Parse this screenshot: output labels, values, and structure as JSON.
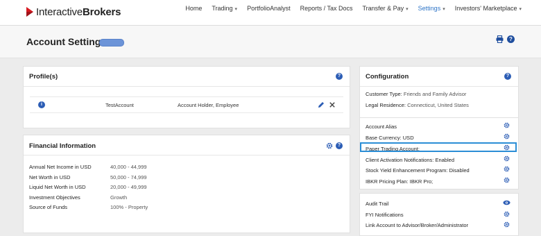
{
  "logo": {
    "part1": "Interactive",
    "part2": "Brokers"
  },
  "nav": [
    {
      "label": "Home",
      "caret": false
    },
    {
      "label": "Trading",
      "caret": true
    },
    {
      "label": "PortfolioAnalyst",
      "caret": false
    },
    {
      "label": "Reports / Tax Docs",
      "caret": false
    },
    {
      "label": "Transfer & Pay",
      "caret": true
    },
    {
      "label": "Settings",
      "caret": true,
      "active": true
    },
    {
      "label": "Investors' Marketplace",
      "caret": true
    }
  ],
  "page": {
    "title": "Account Settings"
  },
  "colors": {
    "accent": "#2c5db5",
    "highlight": "#2b8ed6",
    "brand": "#d71920"
  },
  "profiles": {
    "title": "Profile(s)",
    "row": {
      "name": "TestAccount",
      "role": "Account Holder, Employee"
    }
  },
  "financial": {
    "title": "Financial Information",
    "rows": [
      {
        "label": "Annual Net Income in USD",
        "value": "40,000 - 44,999"
      },
      {
        "label": "Net Worth in USD",
        "value": "50,000 - 74,999"
      },
      {
        "label": "Liquid Net Worth in USD",
        "value": "20,000 - 49,999"
      },
      {
        "label": "Investment Objectives",
        "value": "Growth"
      },
      {
        "label": "Source of Funds",
        "value": "100% - Property"
      }
    ]
  },
  "configuration": {
    "title": "Configuration",
    "customer_type_label": "Customer Type:",
    "customer_type_value": "Friends and Family Advisor",
    "legal_residence_label": "Legal Residence:",
    "legal_residence_value": "Connecticut, United States",
    "settings": [
      "Account Alias",
      "Base Currency: USD",
      "Paper Trading Account:",
      "Client Activation Notifications: Enabled",
      "Stock Yield Enhancement Program: Disabled",
      "IBKR Pricing Plan: IBKR Pro;"
    ],
    "extra": [
      {
        "label": "Audit Trail",
        "icon": "eye-icon"
      },
      {
        "label": "FYI Notifications",
        "icon": "gear-icon"
      },
      {
        "label": "Link Account to Advisor/Broker/Administrator",
        "icon": "gear-icon"
      }
    ]
  }
}
